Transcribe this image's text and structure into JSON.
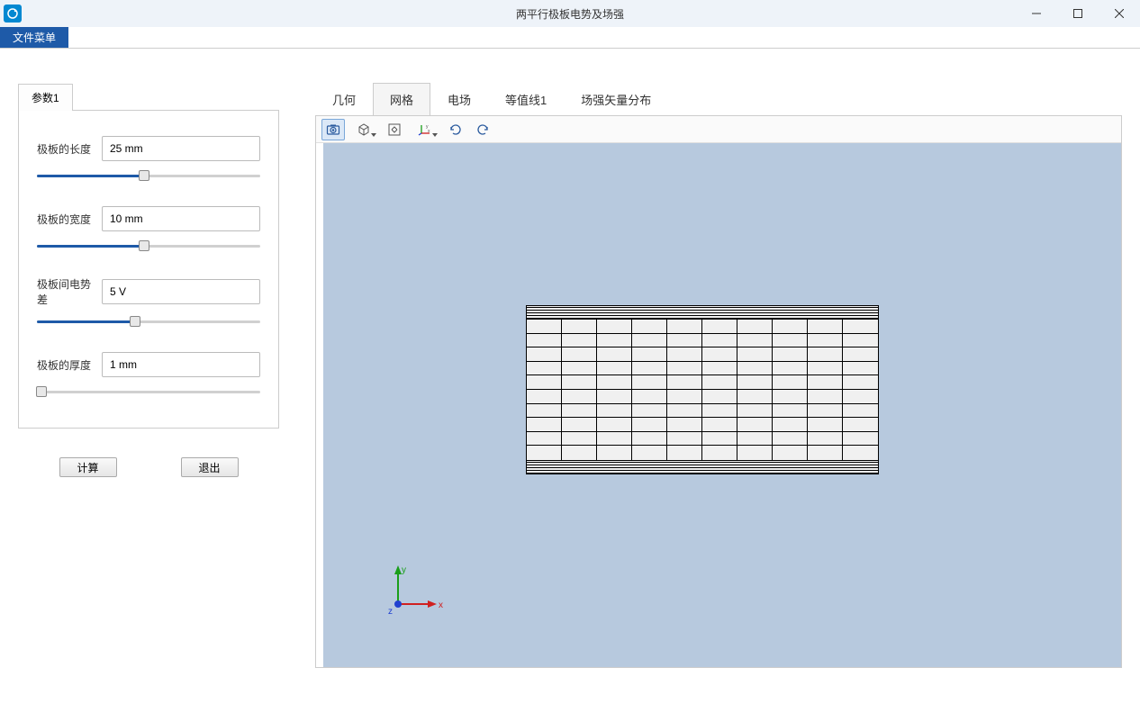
{
  "window": {
    "title": "两平行极板电势及场强"
  },
  "menu": {
    "file": "文件菜单"
  },
  "params": {
    "tab_label": "参数1",
    "fields": [
      {
        "label": "极板的长度",
        "value": "25 mm",
        "slider_percent": 48
      },
      {
        "label": "极板的宽度",
        "value": "10 mm",
        "slider_percent": 48
      },
      {
        "label": "极板间电势差",
        "value": "5 V",
        "slider_percent": 44
      },
      {
        "label": "极板的厚度",
        "value": "1 mm",
        "slider_percent": 2
      }
    ]
  },
  "buttons": {
    "compute": "计算",
    "exit": "退出"
  },
  "tabs": {
    "items": [
      "几何",
      "网格",
      "电场",
      "等值线1",
      "场强矢量分布"
    ],
    "active_index": 1
  },
  "triad": {
    "x": "x",
    "y": "y",
    "z": "z"
  }
}
